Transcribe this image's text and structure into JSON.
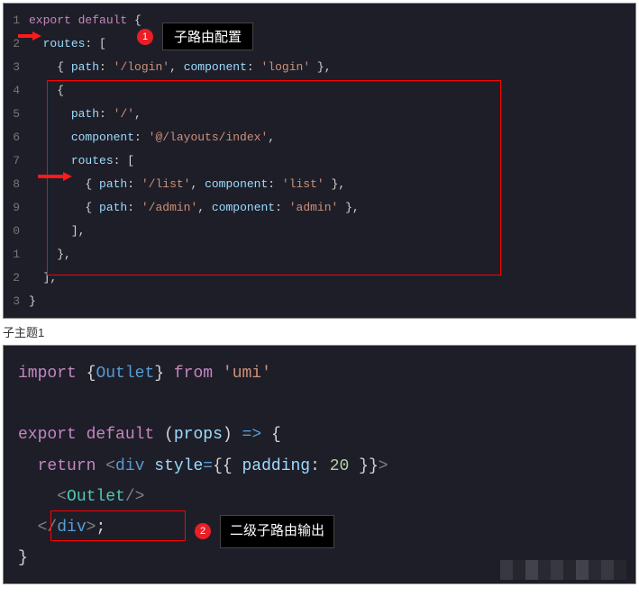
{
  "chart_data": {
    "type": "table",
    "title": "Code screenshot — umi routes config and Outlet usage",
    "snippet1_lines": [
      "export default {",
      "  routes: [",
      "    { path: '/login', component: 'login' },",
      "    {",
      "      path: '/',",
      "      component: '@/layouts/index',",
      "      routes: [",
      "        { path: '/list', component: 'list' },",
      "        { path: '/admin', component: 'admin' },",
      "      ],",
      "    },",
      "  ],",
      "}"
    ],
    "snippet2_lines": [
      "import {Outlet} from 'umi'",
      "",
      "export default (props) => {",
      "  return <div style={{ padding: 20 }}>",
      "    <Outlet/>",
      "  </div>;",
      "}"
    ]
  },
  "block1": {
    "line_numbers": [
      "1",
      "2",
      "3",
      "4",
      "5",
      "6",
      "7",
      "8",
      "9",
      "0",
      "1",
      "2",
      "3"
    ],
    "annotation": {
      "num": "1",
      "label": "子路由配置"
    }
  },
  "caption": "子主题1",
  "block2": {
    "annotation": {
      "num": "2",
      "label": "二级子路由输出"
    }
  },
  "tokens": {
    "export": "export",
    "default": "default",
    "import": "import",
    "from": "from",
    "return": "return",
    "routes": "routes",
    "path": "path",
    "component": "component",
    "props": "props",
    "style": "style",
    "padding": "padding",
    "login_p": "'/login'",
    "login_c": "'login'",
    "root_p": "'/'",
    "layout_c": "'@/layouts/index'",
    "list_p": "'/list'",
    "list_c": "'list'",
    "admin_p": "'/admin'",
    "admin_c": "'admin'",
    "umi": "'umi'",
    "div": "div",
    "Outlet": "Outlet",
    "twenty": "20"
  }
}
